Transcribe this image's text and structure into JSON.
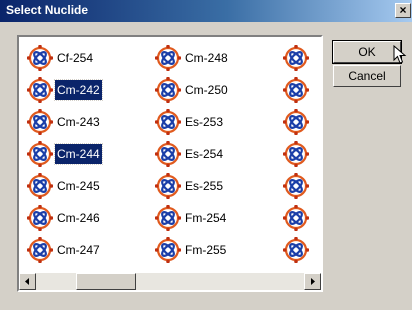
{
  "window": {
    "title": "Select Nuclide",
    "close_glyph": "×"
  },
  "list": {
    "columns": [
      [
        "Cf-254",
        "Cm-242",
        "Cm-243",
        "Cm-244",
        "Cm-245",
        "Cm-246",
        "Cm-247"
      ],
      [
        "Cm-248",
        "Cm-250",
        "Es-253",
        "Es-254",
        "Es-255",
        "Fm-254",
        "Fm-255"
      ],
      [
        "",
        "",
        "",
        "",
        "",
        "",
        ""
      ]
    ],
    "selected": [
      "Cm-242",
      "Cm-244"
    ],
    "icon": "nuclide-atom-icon",
    "selection_color": "#0a246a"
  },
  "buttons": {
    "ok_label": "OK",
    "cancel_label": "Cancel"
  },
  "scrollbar": {
    "left_arrow": "◄",
    "right_arrow": "►"
  }
}
